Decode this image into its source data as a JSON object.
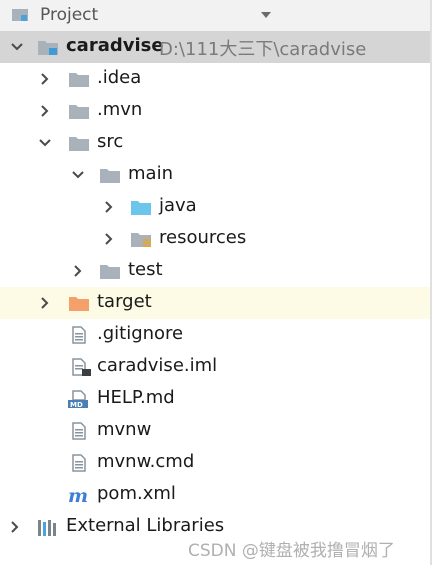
{
  "panel": {
    "title": "Project",
    "dropdown_icon": "caret-down-icon"
  },
  "tree": {
    "root": {
      "label": "caradvise",
      "path": "D:\\111大三下\\caradvise",
      "icon": "module-folder-icon"
    },
    "idea": {
      "label": ".idea"
    },
    "mvn": {
      "label": ".mvn"
    },
    "src": {
      "label": "src"
    },
    "main": {
      "label": "main"
    },
    "java": {
      "label": "java",
      "icon": "source-root-folder-icon"
    },
    "resources": {
      "label": "resources",
      "icon": "resources-root-folder-icon"
    },
    "test": {
      "label": "test"
    },
    "target": {
      "label": "target",
      "icon": "excluded-folder-icon"
    },
    "gitignore": {
      "label": ".gitignore"
    },
    "iml": {
      "label": "caradvise.iml"
    },
    "help": {
      "label": "HELP.md",
      "icon": "markdown-file-icon"
    },
    "mvnw": {
      "label": "mvnw"
    },
    "mvnwcmd": {
      "label": "mvnw.cmd"
    },
    "pom": {
      "label": "pom.xml",
      "icon": "maven-icon"
    },
    "libs": {
      "label": "External Libraries",
      "icon": "library-icon"
    }
  },
  "colors": {
    "folder": "#a9b2bb",
    "source_folder": "#6cc5ea",
    "excluded_folder": "#f5a06a",
    "maven": "#3d7ed6"
  },
  "watermark": "CSDN @键盘被我撸冒烟了"
}
